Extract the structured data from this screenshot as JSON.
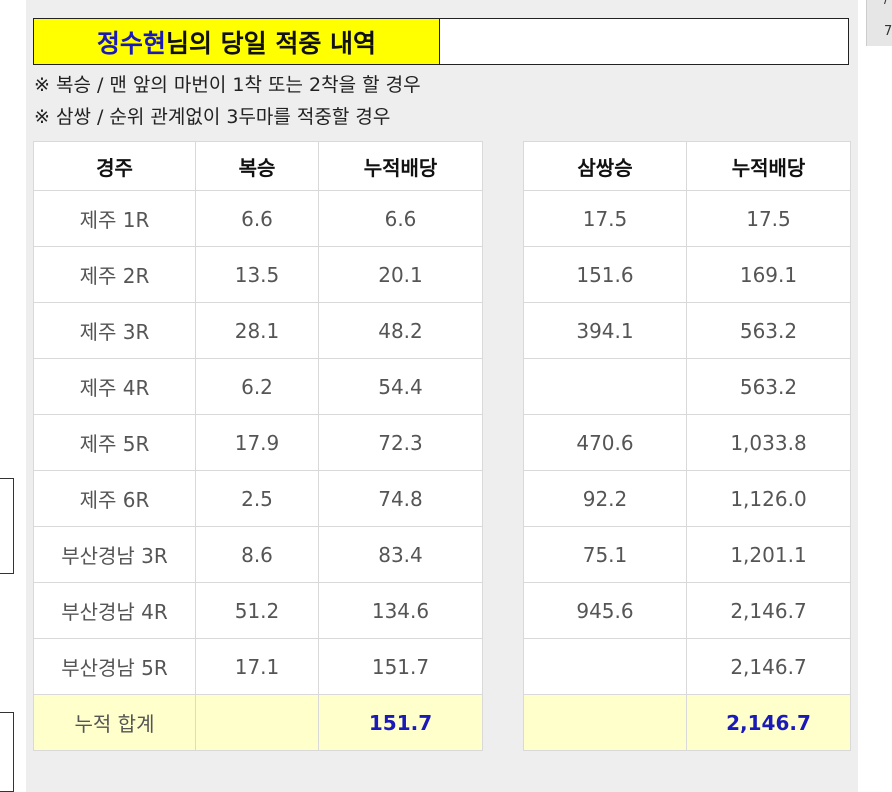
{
  "title": {
    "name": "정수현",
    "rest": "님의 당일 적중 내역"
  },
  "notes": [
    "※ 복승 / 맨 앞의 마번이 1착 또는 2착을 할 경우",
    "※ 삼쌍 / 순위 관계없이 3두마를 적중할 경우"
  ],
  "headers": [
    "경주",
    "복승",
    "누적배당",
    "삼쌍승",
    "누적배당"
  ],
  "rows": [
    {
      "race": "제주 1R",
      "boksung": "6.6",
      "cum1": "6.6",
      "samssang": "17.5",
      "cum2": "17.5"
    },
    {
      "race": "제주 2R",
      "boksung": "13.5",
      "cum1": "20.1",
      "samssang": "151.6",
      "cum2": "169.1"
    },
    {
      "race": "제주 3R",
      "boksung": "28.1",
      "cum1": "48.2",
      "samssang": "394.1",
      "cum2": "563.2"
    },
    {
      "race": "제주 4R",
      "boksung": "6.2",
      "cum1": "54.4",
      "samssang": "",
      "cum2": "563.2"
    },
    {
      "race": "제주 5R",
      "boksung": "17.9",
      "cum1": "72.3",
      "samssang": "470.6",
      "cum2": "1,033.8"
    },
    {
      "race": "제주 6R",
      "boksung": "2.5",
      "cum1": "74.8",
      "samssang": "92.2",
      "cum2": "1,126.0"
    },
    {
      "race": "부산경남 3R",
      "boksung": "8.6",
      "cum1": "83.4",
      "samssang": "75.1",
      "cum2": "1,201.1"
    },
    {
      "race": "부산경남 4R",
      "boksung": "51.2",
      "cum1": "134.6",
      "samssang": "945.6",
      "cum2": "2,146.7"
    },
    {
      "race": "부산경남 5R",
      "boksung": "17.1",
      "cum1": "151.7",
      "samssang": "",
      "cum2": "2,146.7"
    }
  ],
  "total": {
    "label": "누적 합계",
    "cum1": "151.7",
    "cum2": "2,146.7"
  },
  "corner": {
    "line1": "/",
    "line2": "7"
  },
  "colors": {
    "title_bg": "#ffff00",
    "accent": "#1a1ab8",
    "total_bg": "#ffffcc",
    "panel_bg": "#eeeeee"
  }
}
